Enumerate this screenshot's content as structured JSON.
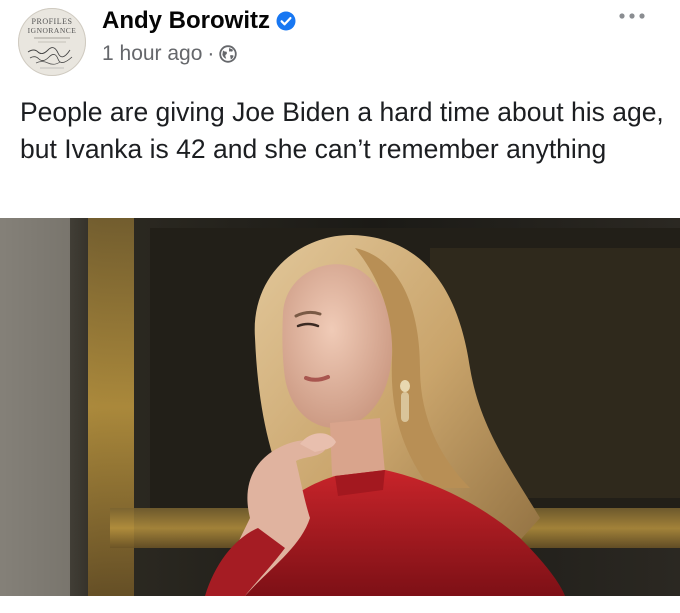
{
  "author": {
    "name": "Andy Borowitz",
    "avatar_text_line1": "PROFILES",
    "avatar_text_line2": "IGNORANCE"
  },
  "meta": {
    "time": "1 hour ago",
    "separator": "·",
    "privacy_icon": "globe-icon"
  },
  "post": {
    "text": "People are giving Joe Biden a hard time about his age, but Ivanka is 42 and she can’t remember anything"
  },
  "icons": {
    "verified": "verified-badge-icon",
    "more": "more-options-icon"
  },
  "colors": {
    "verified_blue": "#1877f2",
    "meta_gray": "#65676b"
  }
}
